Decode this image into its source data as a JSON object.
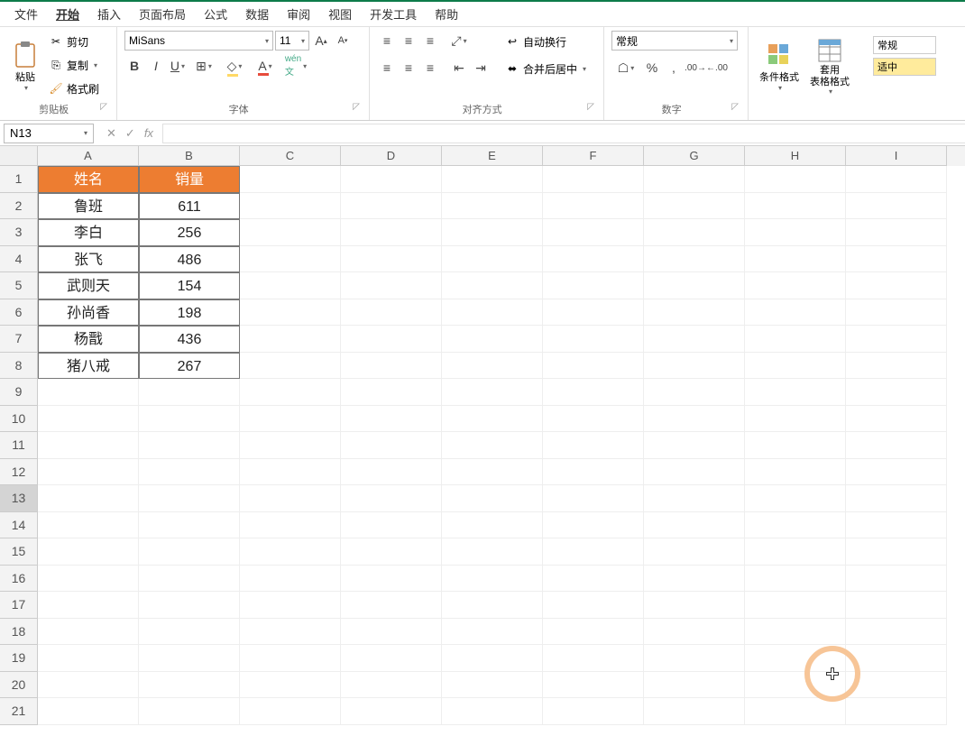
{
  "menu": {
    "items": [
      "文件",
      "开始",
      "插入",
      "页面布局",
      "公式",
      "数据",
      "审阅",
      "视图",
      "开发工具",
      "帮助"
    ],
    "active_index": 1
  },
  "ribbon": {
    "clipboard": {
      "paste": "粘贴",
      "cut": "剪切",
      "copy": "复制",
      "format_painter": "格式刷",
      "label": "剪贴板"
    },
    "font": {
      "name": "MiSans",
      "size": "11",
      "label": "字体"
    },
    "alignment": {
      "wrap": "自动换行",
      "merge": "合并后居中",
      "label": "对齐方式"
    },
    "number": {
      "format": "常规",
      "label": "数字"
    },
    "styles": {
      "cond": "条件格式",
      "table": "套用\n表格格式",
      "normal": "常规",
      "good": "适中"
    }
  },
  "formula_bar": {
    "cell_ref": "N13",
    "formula": ""
  },
  "columns": [
    "A",
    "B",
    "C",
    "D",
    "E",
    "F",
    "G",
    "H",
    "I"
  ],
  "rows_count": 21,
  "selected_row": 13,
  "chart_data": {
    "type": "table",
    "headers": [
      "姓名",
      "销量"
    ],
    "rows": [
      [
        "鲁班",
        "611"
      ],
      [
        "李白",
        "256"
      ],
      [
        "张飞",
        "486"
      ],
      [
        "武则天",
        "154"
      ],
      [
        "孙尚香",
        "198"
      ],
      [
        "杨戬",
        "436"
      ],
      [
        "猪八戒",
        "267"
      ]
    ]
  }
}
